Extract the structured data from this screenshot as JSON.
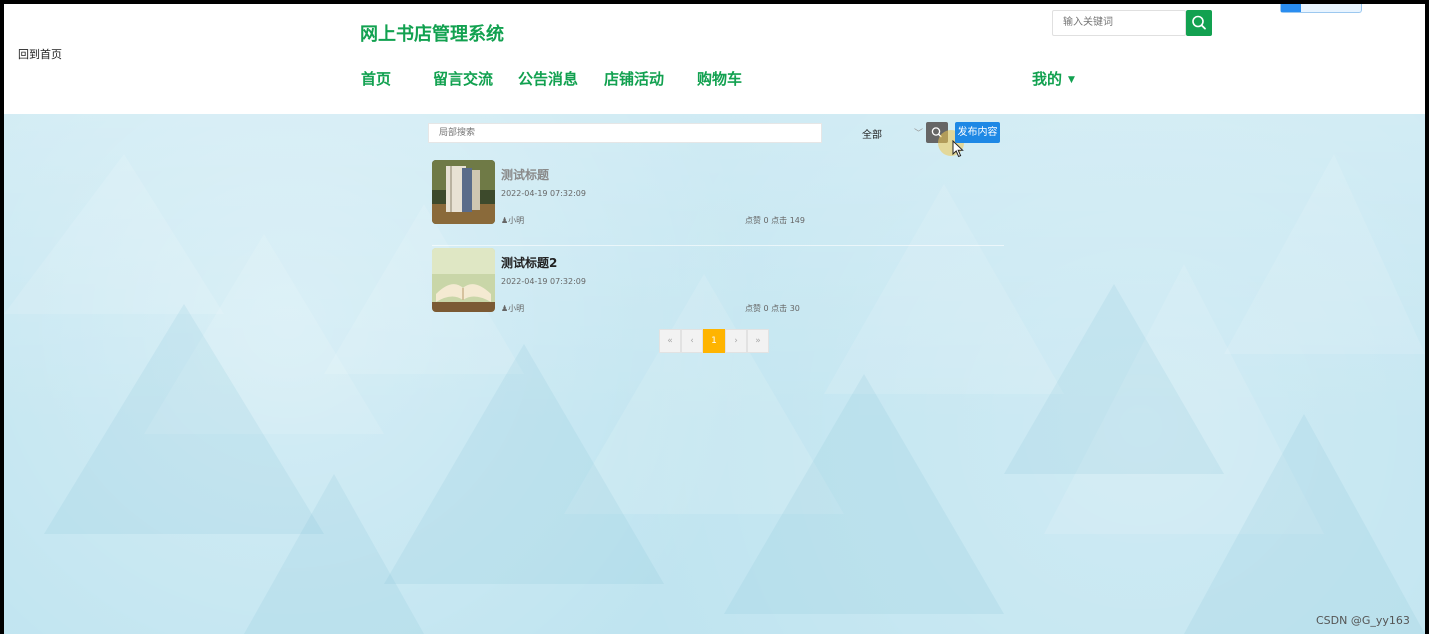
{
  "header": {
    "back_label": "回到首页",
    "site_title": "网上书店管理系统",
    "nav": [
      {
        "label": "首页"
      },
      {
        "label": "留言交流"
      },
      {
        "label": "公告消息"
      },
      {
        "label": "店铺活动"
      },
      {
        "label": "购物车"
      }
    ],
    "mine_label": "我的",
    "search_placeholder": "输入关键词"
  },
  "toolbar": {
    "local_search_placeholder": "局部搜索",
    "filter_value": "全部",
    "publish_label": "发布内容"
  },
  "posts": [
    {
      "title": "测试标题",
      "date": "2022-04-19 07:32:09",
      "author": "小明",
      "stats": "点赞 0 点击 149",
      "title_color": "#8a8a8a"
    },
    {
      "title": "测试标题2",
      "date": "2022-04-19 07:32:09",
      "author": "小明",
      "stats": "点赞 0 点击 30",
      "title_color": "#222222"
    }
  ],
  "pagination": {
    "first": "«",
    "prev": "‹",
    "current": "1",
    "next": "›",
    "last": "»"
  },
  "watermark": "CSDN @G_yy163",
  "colors": {
    "brand_green": "#12a150",
    "publish_blue": "#1e88e5",
    "page_active": "#ffb400"
  }
}
